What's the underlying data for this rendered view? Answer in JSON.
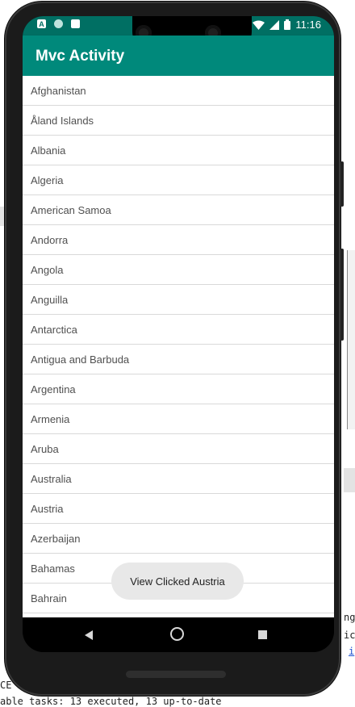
{
  "status_bar": {
    "time": "11:16",
    "left_icons": [
      "a-notification-icon",
      "circle-notification-icon",
      "sd-card-icon"
    ],
    "right_icons": [
      "wifi-icon",
      "cell-signal-icon",
      "battery-icon"
    ]
  },
  "app_bar": {
    "title": "Mvc Activity"
  },
  "list": {
    "items": [
      "Afghanistan",
      "Åland Islands",
      "Albania",
      "Algeria",
      "American Samoa",
      "Andorra",
      "Angola",
      "Anguilla",
      "Antarctica",
      "Antigua and Barbuda",
      "Argentina",
      "Armenia",
      "Aruba",
      "Australia",
      "Austria",
      "Azerbaijan",
      "Bahamas",
      "Bahrain"
    ]
  },
  "toast": {
    "text": "View Clicked Austria"
  },
  "background": {
    "line_ng": "ng",
    "line_ic": "ic",
    "line_i": "i",
    "line_ce": "CE",
    "line_tasks": "able tasks: 13 executed, 13 up-to-date"
  },
  "colors": {
    "status_bar": "#006f63",
    "app_bar": "#00897b",
    "toast_bg": "#e8e8e8"
  }
}
